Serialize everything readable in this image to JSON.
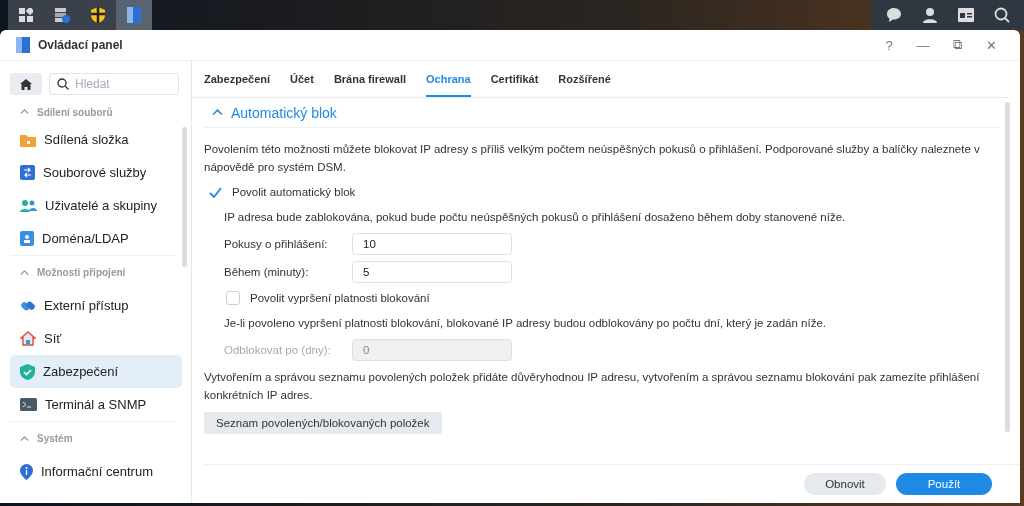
{
  "window": {
    "title": "Ovládací panel",
    "controls": [
      "?",
      "—",
      "⧉",
      "✕"
    ]
  },
  "search": {
    "placeholder": "Hledat"
  },
  "sidebar": {
    "items": [
      {
        "kind": "header",
        "label": "Sdílení souborů",
        "expanded": true
      },
      {
        "kind": "item",
        "label": "Sdílená složka",
        "selected": false
      },
      {
        "kind": "item",
        "label": "Souborové služby",
        "selected": false
      },
      {
        "kind": "item",
        "label": "Uživatelé a skupiny",
        "selected": false
      },
      {
        "kind": "item",
        "label": "Doména/LDAP",
        "selected": false
      },
      {
        "kind": "header",
        "label": "Možnosti připojení",
        "expanded": true
      },
      {
        "kind": "item",
        "label": "Externí přístup",
        "selected": false
      },
      {
        "kind": "item",
        "label": "Síť",
        "selected": false
      },
      {
        "kind": "item",
        "label": "Zabezpečení",
        "selected": true
      },
      {
        "kind": "item",
        "label": "Terminál a SNMP",
        "selected": false
      },
      {
        "kind": "header",
        "label": "Systém",
        "expanded": true
      },
      {
        "kind": "item",
        "label": "Informační centrum",
        "selected": false
      }
    ]
  },
  "tabs": [
    {
      "label": "Zabezpečení",
      "selected": false
    },
    {
      "label": "Účet",
      "selected": false
    },
    {
      "label": "Brána firewall",
      "selected": false
    },
    {
      "label": "Ochrana",
      "selected": true
    },
    {
      "label": "Certifikát",
      "selected": false
    },
    {
      "label": "Rozšířené",
      "selected": false
    }
  ],
  "section": {
    "title": "Automatický blok",
    "expanded": true
  },
  "content": [
    {
      "kind": "text",
      "text": "Povolením této možnosti můžete blokovat IP adresy s příliš velkým počtem neúspěšných pokusů o přihlášení. Podporované služby a balíčky naleznete v nápovědě pro systém DSM."
    },
    {
      "kind": "checkbox",
      "label": "Povolit automatický blok",
      "checked": true
    },
    {
      "kind": "subtext",
      "text": "IP adresa bude zablokována, pokud bude počtu neúspěšných pokusů o přihlášení dosaženo během doby stanovené níže."
    },
    {
      "kind": "field",
      "label": "Pokusy o přihlášení:",
      "value": "10",
      "disabled": false
    },
    {
      "kind": "field",
      "label": "Během (minuty):",
      "value": "5",
      "disabled": false
    },
    {
      "kind": "subcheckbox",
      "label": "Povolit vypršení platnosti blokování",
      "checked": false
    },
    {
      "kind": "subtext",
      "text": "Je-li povoleno vypršení platnosti blokování, blokované IP adresy budou odblokovány po počtu dní, který je zadán níže."
    },
    {
      "kind": "field",
      "label": "Odblokovat po (dny):",
      "value": "0",
      "disabled": true
    },
    {
      "kind": "text",
      "text": "Vytvořením a správou seznamu povolených položek přidáte důvěryhodnou IP adresu, vytvořením a správou seznamu blokování pak zamezíte přihlášení konkrétních IP adres."
    },
    {
      "kind": "button",
      "label": "Seznam povolených/blokovaných položek"
    }
  ],
  "footer": {
    "buttons": [
      {
        "label": "Obnovit",
        "kind": "secondary"
      },
      {
        "label": "Použít",
        "kind": "primary"
      }
    ]
  }
}
